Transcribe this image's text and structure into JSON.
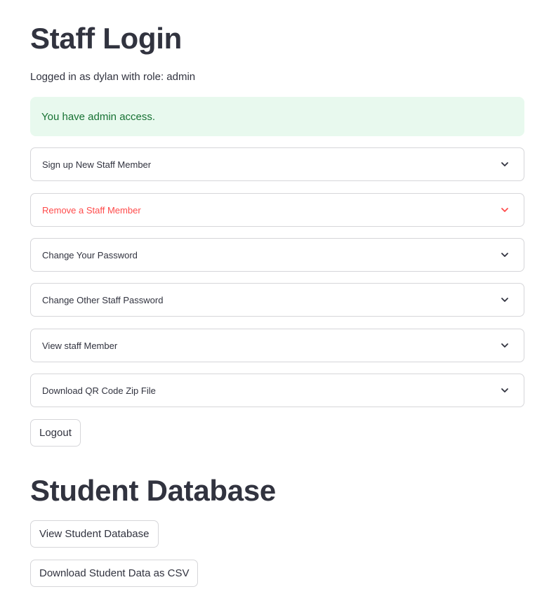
{
  "page": {
    "title": "Staff Login",
    "logged_in_text": "Logged in as dylan with role: admin"
  },
  "alert": {
    "message": "You have admin access.",
    "color": "#177233",
    "background": "#e8f9ee"
  },
  "expanders": [
    {
      "label": "Sign up New Staff Member",
      "icon": "chevron-down-icon",
      "state": "collapsed"
    },
    {
      "label": "Remove a Staff Member",
      "icon": "chevron-down-icon",
      "state": "hovered"
    },
    {
      "label": "Change Your Password",
      "icon": "chevron-down-icon",
      "state": "collapsed"
    },
    {
      "label": "Change Other Staff Password",
      "icon": "chevron-down-icon",
      "state": "collapsed"
    },
    {
      "label": "View staff Member",
      "icon": "chevron-down-icon",
      "state": "collapsed"
    },
    {
      "label": "Download QR Code Zip File",
      "icon": "chevron-down-icon",
      "state": "collapsed"
    }
  ],
  "buttons": {
    "logout": "Logout"
  },
  "student_section": {
    "title": "Student Database",
    "view_button": "View Student Database",
    "download_button": "Download Student Data as CSV"
  },
  "colors": {
    "text": "#31333f",
    "hover_accent": "#ff4b4b",
    "border": "#d6d6d9"
  }
}
